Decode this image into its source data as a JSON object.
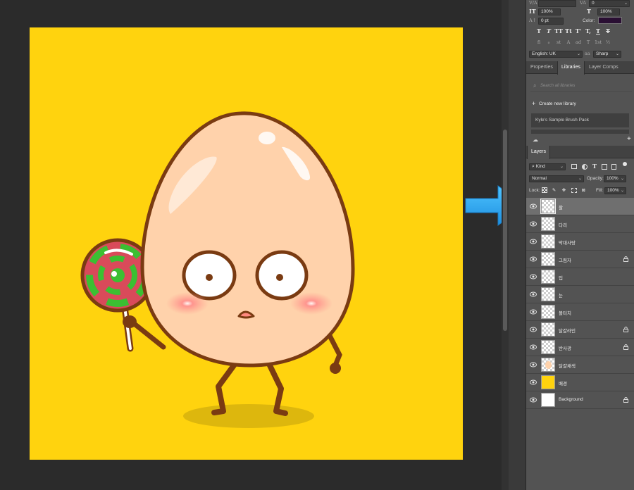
{
  "character_panel": {
    "row1": {
      "left_value": "",
      "right_value": "0"
    },
    "row2": {
      "left_value": "100%",
      "right_value": "100%"
    },
    "row3": {
      "baseline_value": "0 pt",
      "color_label": "Color:",
      "color_swatch": "#2a0f33"
    },
    "type_style_icons": [
      "T",
      "T",
      "TT",
      "Tt",
      "T'",
      "T,",
      "T",
      "T"
    ],
    "opentype_icons": [
      "fi",
      "ℴ",
      "st",
      "A",
      "ad",
      "T",
      "1st",
      "½"
    ],
    "language": "English: UK",
    "antialias": "Sharp"
  },
  "tabs": {
    "properties": "Properties",
    "libraries": "Libraries",
    "layer_comps": "Layer Comps"
  },
  "libraries": {
    "search_placeholder": "Search all libraries",
    "create_new": "Create new library",
    "item": "Kyle's Sample Brush Pack"
  },
  "layers_panel": {
    "tab": "Layers",
    "filter_kind": "Kind",
    "blend_mode": "Normal",
    "opacity_label": "Opacity:",
    "opacity_value": "100%",
    "lock_label": "Lock:",
    "fill_label": "Fill:",
    "fill_value": "100%",
    "layers": [
      {
        "name": "팔",
        "thumb": "transparent",
        "locked": false,
        "selected": true
      },
      {
        "name": "다리",
        "thumb": "transparent",
        "locked": false,
        "selected": false
      },
      {
        "name": "막대사탕",
        "thumb": "transparent",
        "locked": false,
        "selected": false
      },
      {
        "name": "그림자",
        "thumb": "transparent",
        "locked": true,
        "selected": false
      },
      {
        "name": "입",
        "thumb": "transparent",
        "locked": false,
        "selected": false
      },
      {
        "name": "눈",
        "thumb": "transparent",
        "locked": false,
        "selected": false
      },
      {
        "name": "볼터치",
        "thumb": "transparent",
        "locked": false,
        "selected": false
      },
      {
        "name": "달걀라인",
        "thumb": "transparent",
        "locked": true,
        "selected": false
      },
      {
        "name": "반사광",
        "thumb": "transparent",
        "locked": true,
        "selected": false
      },
      {
        "name": "달걀채색",
        "thumb": "transparent",
        "locked": false,
        "selected": false
      },
      {
        "name": "배경",
        "thumb": "yellow",
        "locked": false,
        "selected": false
      },
      {
        "name": "Background",
        "thumb": "white",
        "locked": true,
        "selected": false
      }
    ]
  },
  "colors": {
    "canvas_background": "#ffd30e",
    "panel": "#535353",
    "arrow": "#2aa8f0"
  }
}
